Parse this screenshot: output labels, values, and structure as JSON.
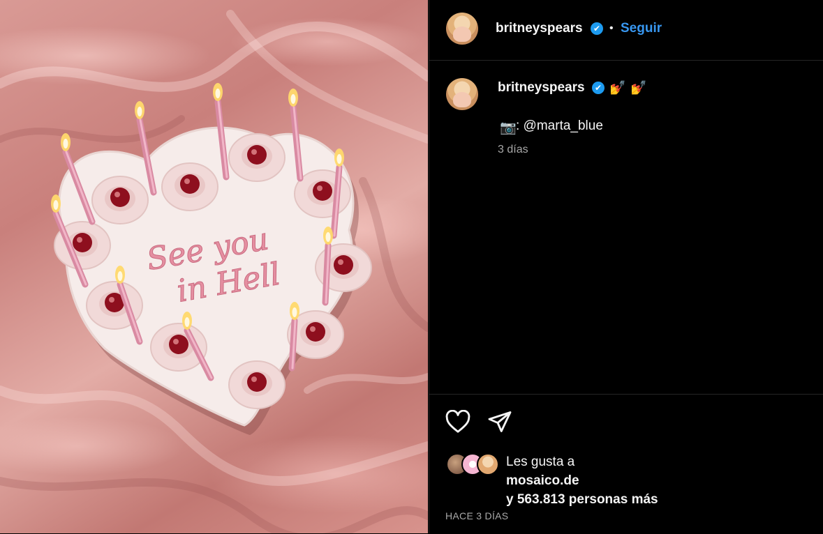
{
  "post": {
    "username": "britneyspears",
    "verified_mark": "✔",
    "separator": "•",
    "follow_label": "Seguir",
    "caption": {
      "emojis": [
        "💅",
        "💅"
      ],
      "camera_emoji": "📷",
      "credit": ": @marta_blue",
      "age": "3 días"
    },
    "image": {
      "cake_text_line1": "See you",
      "cake_text_line2": "in Hell"
    },
    "likes": {
      "prefix": "Les gusta a",
      "liker": "mosaico.de",
      "rest": "y 563.813 personas más"
    },
    "date": "HACE 3 DÍAS",
    "icons": [
      "heart-icon",
      "share-icon"
    ]
  },
  "colors": {
    "accent": "#3897f0",
    "verified": "#1d9bf0",
    "background": "#000000",
    "muted": "#a8a8a8"
  }
}
